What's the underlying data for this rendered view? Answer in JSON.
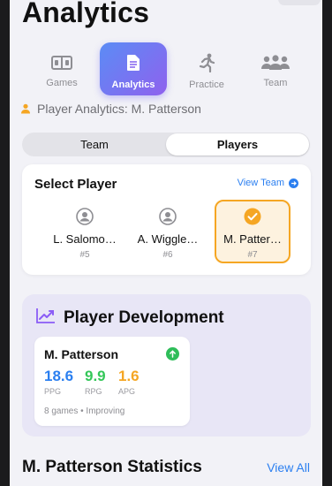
{
  "header": {
    "title": "Analytics"
  },
  "modes": [
    {
      "label": "Games",
      "icon": "scoreboard-icon",
      "active": false
    },
    {
      "label": "Analytics",
      "icon": "document-icon",
      "active": true
    },
    {
      "label": "Practice",
      "icon": "running-figure-icon",
      "active": false
    },
    {
      "label": "Team",
      "icon": "people-group-icon",
      "active": false
    }
  ],
  "context": {
    "text": "Player Analytics: M. Patterson",
    "icon": "person-icon",
    "icon_color": "#f5a623"
  },
  "segmented": {
    "options": [
      "Team",
      "Players"
    ],
    "selected": "Players"
  },
  "select_player": {
    "title": "Select Player",
    "link": "View Team",
    "players": [
      {
        "name": "L. Salomo…",
        "number": "#5",
        "selected": false
      },
      {
        "name": "A. Wiggle…",
        "number": "#6",
        "selected": false
      },
      {
        "name": "M. Patter…",
        "number": "#7",
        "selected": true
      }
    ]
  },
  "development": {
    "title": "Player Development",
    "card": {
      "name": "M. Patterson",
      "trend": "up",
      "metrics": [
        {
          "value": "18.6",
          "label": "PPG",
          "color": "#2b7ff0"
        },
        {
          "value": "9.9",
          "label": "RPG",
          "color": "#34c759"
        },
        {
          "value": "1.6",
          "label": "APG",
          "color": "#f5a623"
        }
      ],
      "footer": "8 games • Improving"
    }
  },
  "statistics": {
    "title": "M. Patterson Statistics",
    "link": "View All"
  },
  "colors": {
    "accent": "#2b7ff0",
    "selection": "#f5a623",
    "gradient_start": "#5b8cf5",
    "gradient_end": "#8f61ee"
  }
}
